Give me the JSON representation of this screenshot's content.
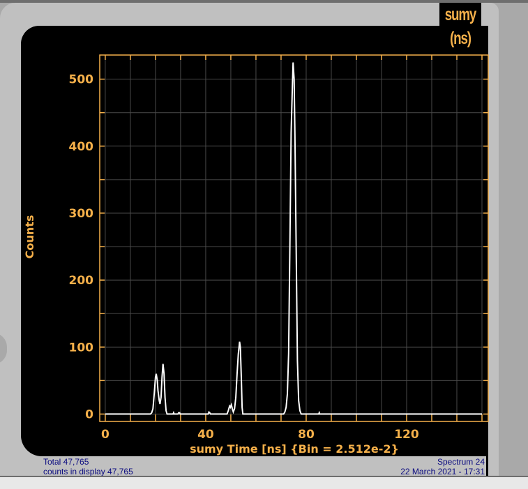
{
  "window": {
    "title": "sumy (ns)"
  },
  "status": {
    "total": "Total 47,765",
    "counts_in_display": "counts in display 47,765",
    "spectrum": "Spectrum 24",
    "date": "22 March 2021 - 17:31"
  },
  "colors": {
    "axis": "#f5b04a",
    "grid": "#4a4a4a",
    "trace": "#ffffff",
    "status_text": "#0b0b80"
  },
  "chart_data": {
    "type": "line",
    "title": "sumy (ns)",
    "xlabel": "sumy Time [ns] {Bin = 2.512e-2}",
    "ylabel": "Counts",
    "xlim": [
      -2.2,
      152.5
    ],
    "ylim": [
      -11,
      536
    ],
    "xticks": [
      0,
      40,
      80,
      120
    ],
    "xtick_labels": [
      "0",
      "40",
      "80",
      "120"
    ],
    "yticks": [
      0,
      100,
      200,
      300,
      400,
      500
    ],
    "ytick_labels": [
      "0",
      "100",
      "200",
      "300",
      "400",
      "500"
    ],
    "x_grid_step": 10,
    "y_grid_step": 50,
    "grid": true,
    "series": [
      {
        "name": "sumy",
        "x": [
          0,
          18,
          18.5,
          19,
          19.5,
          20,
          20.3,
          20.7,
          21,
          21.5,
          21.8,
          22.2,
          22.6,
          23,
          23.4,
          23.8,
          24.2,
          24.6,
          27,
          27.2,
          27.4,
          29,
          29.2,
          29.6,
          29.8,
          41,
          41.3,
          41.6,
          41.9,
          48.5,
          49,
          49.5,
          49.8,
          50.2,
          50.6,
          51,
          51.5,
          52,
          52.5,
          53,
          53.5,
          53.8,
          54.2,
          54.5,
          54.8,
          71,
          71.5,
          72,
          72.5,
          73,
          73.5,
          74,
          74.5,
          74.8,
          75.2,
          75.5,
          76,
          76.5,
          77,
          77.5,
          78,
          85,
          85.2,
          85.4,
          150
        ],
        "y": [
          0,
          0,
          2,
          8,
          30,
          55,
          60,
          50,
          35,
          20,
          15,
          25,
          55,
          75,
          60,
          25,
          5,
          0,
          0,
          2,
          0,
          0,
          2,
          2,
          0,
          0,
          3,
          2,
          0,
          0,
          5,
          12,
          10,
          14,
          8,
          3,
          8,
          25,
          60,
          90,
          108,
          100,
          50,
          10,
          0,
          0,
          3,
          10,
          30,
          90,
          250,
          420,
          490,
          525,
          500,
          420,
          250,
          80,
          20,
          5,
          0,
          0,
          2,
          0,
          0
        ]
      }
    ]
  }
}
